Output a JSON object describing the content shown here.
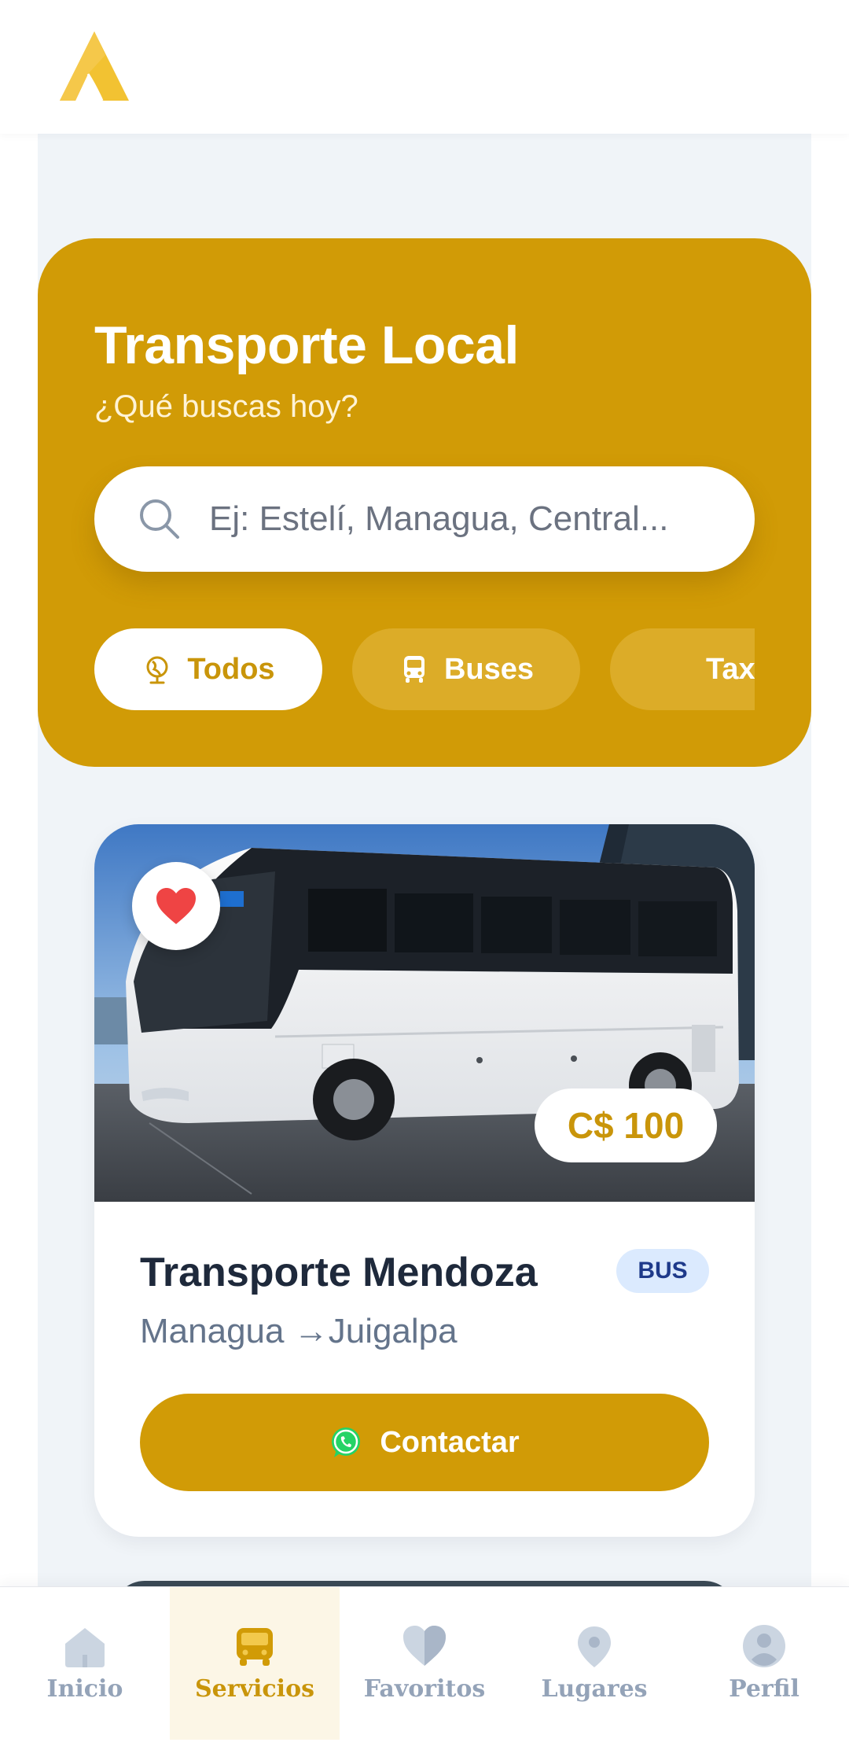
{
  "header": {
    "logo_icon": "app-logo-a-icon"
  },
  "hero": {
    "title": "Transporte Local",
    "subtitle": "¿Qué buscas hoy?",
    "search": {
      "placeholder": "Ej: Estelí, Managua, Central...",
      "value": ""
    },
    "filters": [
      {
        "label": "Todos",
        "icon": "globe-icon",
        "active": true
      },
      {
        "label": "Buses",
        "icon": "bus-icon",
        "active": false
      },
      {
        "label": "Taxis",
        "icon": "taxi-icon",
        "active": false
      }
    ]
  },
  "services": [
    {
      "name": "Transporte Mendoza",
      "type": "BUS",
      "origin": "Managua",
      "arrow": "→",
      "destination": "Juigalpa",
      "price": "C$ 100",
      "favorite": true,
      "contact_label": "Contactar",
      "contact_icon": "whatsapp-icon"
    }
  ],
  "bottom_nav": [
    {
      "label": "Inicio",
      "icon": "home-icon",
      "active": false
    },
    {
      "label": "Servicios",
      "icon": "bus-icon",
      "active": true
    },
    {
      "label": "Favoritos",
      "icon": "heart-icon",
      "active": false
    },
    {
      "label": "Lugares",
      "icon": "location-pin-icon",
      "active": false
    },
    {
      "label": "Perfil",
      "icon": "user-icon",
      "active": false
    }
  ],
  "colors": {
    "brand": "#d19b06",
    "brand_light": "#dcac28",
    "accent_text": "#c9950a",
    "title_dark": "#1e293b",
    "muted": "#64748b",
    "badge_bg": "#dbeafe",
    "badge_text": "#1e3a8a",
    "favorite": "#ef4444",
    "nav_inactive": "#94a3b8"
  }
}
